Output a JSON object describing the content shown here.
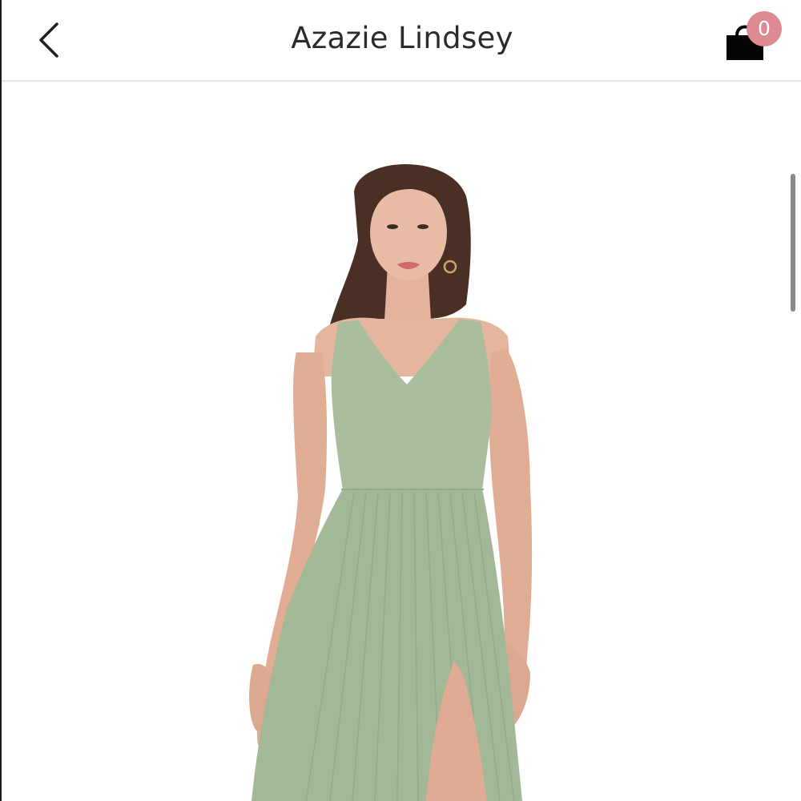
{
  "header": {
    "title": "Azazie Lindsey",
    "back_icon": "chevron-left-icon",
    "cart_icon": "shopping-bag-icon",
    "cart_count": "0",
    "badge_color": "#dd8a93"
  },
  "product": {
    "image_icon": "dress-photo",
    "dress_color": "#a9bd9d"
  }
}
